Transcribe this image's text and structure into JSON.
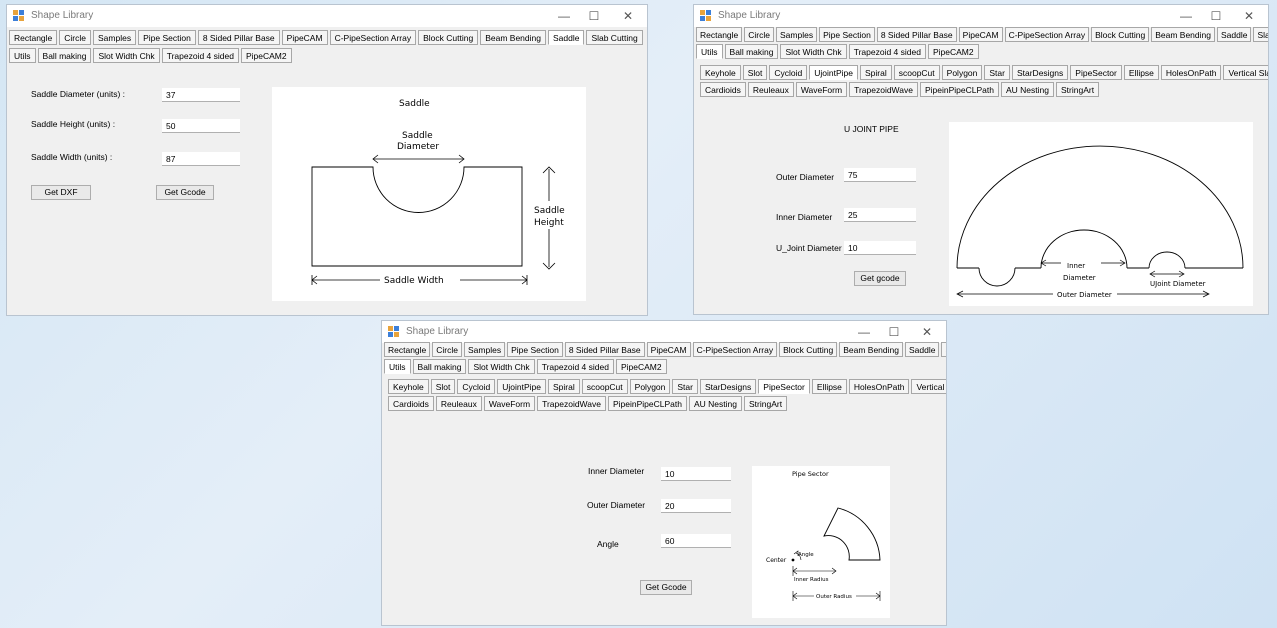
{
  "app_title": "Shape Library",
  "window_controls": {
    "minimize": "—",
    "maximize": "☐",
    "close": "✕"
  },
  "main_tabs": [
    "Rectangle",
    "Circle",
    "Samples",
    "Pipe Section",
    "8 Sided Pillar Base",
    "PipeCAM",
    "C-PipeSection Array",
    "Block Cutting",
    "Beam Bending",
    "Saddle",
    "Slab Cutting"
  ],
  "main_tabs_row2": [
    "Utils",
    "Ball making",
    "Slot Width Chk",
    "Trapezoid 4 sided",
    "PipeCAM2"
  ],
  "utils_tabs_row1": [
    "Keyhole",
    "Slot",
    "Cycloid",
    "UjointPipe",
    "Spiral",
    "scoopCut",
    "Polygon",
    "Star",
    "StarDesigns",
    "PipeSector",
    "Ellipse",
    "HolesOnPath",
    "Vertical Slabs"
  ],
  "utils_tabs_row2": [
    "Cardioids",
    "Reuleaux",
    "WaveForm",
    "TrapezoidWave",
    "PipeinPipeCLPath",
    "AU Nesting",
    "StringArt"
  ],
  "saddle": {
    "fields": [
      {
        "label": "Saddle Diameter (units) :",
        "value": "37"
      },
      {
        "label": "Saddle Height (units) :",
        "value": "50"
      },
      {
        "label": "Saddle Width (units) :",
        "value": "87"
      }
    ],
    "btn_dxf": "Get DXF",
    "btn_gcode": "Get Gcode",
    "fig": {
      "title": "Saddle",
      "diam_line1": "Saddle",
      "diam_line2": "Diameter",
      "height_line1": "Saddle",
      "height_line2": "Height",
      "width": "Saddle Width"
    }
  },
  "ujoint": {
    "heading": "U JOINT PIPE",
    "fields": [
      {
        "label": "Outer Diameter",
        "value": "75"
      },
      {
        "label": "Inner Diameter",
        "value": "25"
      },
      {
        "label": "U_Joint Diameter",
        "value": "10"
      }
    ],
    "btn_gcode": "Get gcode",
    "fig": {
      "inner_line1": "Inner",
      "inner_line2": "Diameter",
      "ujoint": "UJoint Diameter",
      "outer": "Outer Diameter"
    }
  },
  "sector": {
    "fields": [
      {
        "label": "Inner Diameter",
        "value": "10"
      },
      {
        "label": "Outer Diameter",
        "value": "20"
      },
      {
        "label": "Angle",
        "value": "60"
      }
    ],
    "btn_gcode": "Get Gcode",
    "fig": {
      "title": "Pipe Sector",
      "center": "Center",
      "angle": "Angle",
      "inner": "Inner Radius",
      "outer": "Outer Radius"
    }
  }
}
